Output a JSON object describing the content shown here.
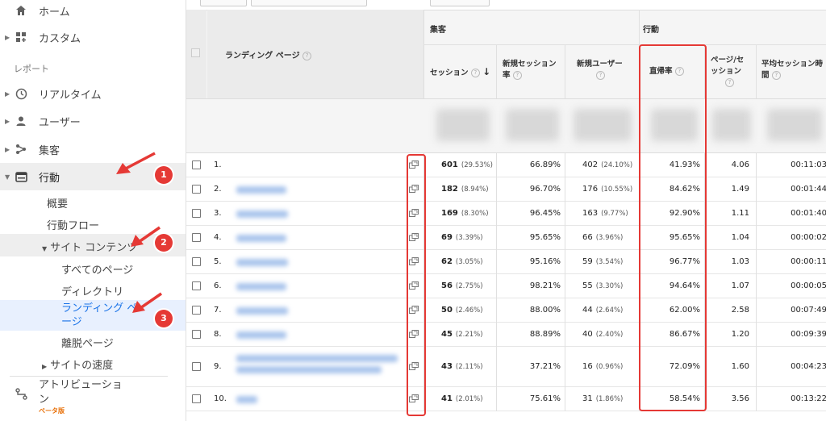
{
  "sidebar": {
    "home": "ホーム",
    "custom": "カスタム",
    "report_section": "レポート",
    "realtime": "リアルタイム",
    "users": "ユーザー",
    "acquisition": "集客",
    "behavior": "行動",
    "overview": "概要",
    "behavior_flow": "行動フロー",
    "site_content": "サイト コンテンツ",
    "all_pages": "すべてのページ",
    "directory": "ディレクトリ",
    "landing_pages": "ランディング ページ",
    "exit_pages": "離脱ページ",
    "site_speed": "サイトの速度",
    "attribution": "アトリビューション",
    "beta": "ベータ版"
  },
  "annotations": [
    "1",
    "2",
    "3"
  ],
  "table": {
    "dimension_header": "ランディング ページ",
    "group_acquisition": "集客",
    "group_behavior": "行動",
    "col_sessions": "セッション",
    "col_new_session_rate_1": "新規セッション",
    "col_new_session_rate_2": "率",
    "col_new_users": "新規ユーザー",
    "col_bounce_rate": "直帰率",
    "col_pages_per_session_1": "ページ/セ",
    "col_pages_per_session_2": "ッション",
    "col_avg_duration_1": "平均セッション時",
    "col_avg_duration_2": "間",
    "rows": [
      {
        "num": "1.",
        "sessions": "601",
        "sessions_pct": "(29.53%)",
        "new_rate": "66.89%",
        "new_users": "402",
        "new_users_pct": "(24.10%)",
        "bounce": "41.93%",
        "pages": "4.06",
        "duration": "00:11:03"
      },
      {
        "num": "2.",
        "sessions": "182",
        "sessions_pct": "(8.94%)",
        "new_rate": "96.70%",
        "new_users": "176",
        "new_users_pct": "(10.55%)",
        "bounce": "84.62%",
        "pages": "1.49",
        "duration": "00:01:44"
      },
      {
        "num": "3.",
        "sessions": "169",
        "sessions_pct": "(8.30%)",
        "new_rate": "96.45%",
        "new_users": "163",
        "new_users_pct": "(9.77%)",
        "bounce": "92.90%",
        "pages": "1.11",
        "duration": "00:01:40"
      },
      {
        "num": "4.",
        "sessions": "69",
        "sessions_pct": "(3.39%)",
        "new_rate": "95.65%",
        "new_users": "66",
        "new_users_pct": "(3.96%)",
        "bounce": "95.65%",
        "pages": "1.04",
        "duration": "00:00:02"
      },
      {
        "num": "5.",
        "sessions": "62",
        "sessions_pct": "(3.05%)",
        "new_rate": "95.16%",
        "new_users": "59",
        "new_users_pct": "(3.54%)",
        "bounce": "96.77%",
        "pages": "1.03",
        "duration": "00:00:11"
      },
      {
        "num": "6.",
        "sessions": "56",
        "sessions_pct": "(2.75%)",
        "new_rate": "98.21%",
        "new_users": "55",
        "new_users_pct": "(3.30%)",
        "bounce": "94.64%",
        "pages": "1.07",
        "duration": "00:00:05"
      },
      {
        "num": "7.",
        "sessions": "50",
        "sessions_pct": "(2.46%)",
        "new_rate": "88.00%",
        "new_users": "44",
        "new_users_pct": "(2.64%)",
        "bounce": "62.00%",
        "pages": "2.58",
        "duration": "00:07:49"
      },
      {
        "num": "8.",
        "sessions": "45",
        "sessions_pct": "(2.21%)",
        "new_rate": "88.89%",
        "new_users": "40",
        "new_users_pct": "(2.40%)",
        "bounce": "86.67%",
        "pages": "1.20",
        "duration": "00:09:39"
      },
      {
        "num": "9.",
        "sessions": "43",
        "sessions_pct": "(2.11%)",
        "new_rate": "37.21%",
        "new_users": "16",
        "new_users_pct": "(0.96%)",
        "bounce": "72.09%",
        "pages": "1.60",
        "duration": "00:04:23"
      },
      {
        "num": "10.",
        "sessions": "41",
        "sessions_pct": "(2.01%)",
        "new_rate": "75.61%",
        "new_users": "31",
        "new_users_pct": "(1.86%)",
        "bounce": "58.54%",
        "pages": "3.56",
        "duration": "00:13:22"
      }
    ]
  },
  "colors": {
    "highlight": "#e53935",
    "accent_beta": "#e8710a",
    "selected_link": "#1a73e8"
  }
}
